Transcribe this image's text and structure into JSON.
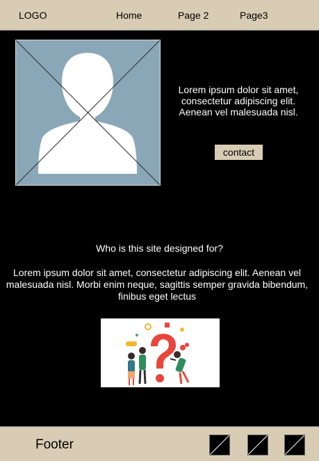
{
  "header": {
    "logo": "LOGO",
    "nav": [
      "Home",
      "Page 2",
      "Page3"
    ]
  },
  "hero": {
    "intro": "Lorem ipsum dolor sit amet, consectetur adipiscing elit. Aenean vel malesuada nisl.",
    "contact_label": "contact",
    "avatar_icon": "user-placeholder-icon"
  },
  "audience": {
    "question": "Who is this site designed for?",
    "body": "Lorem ipsum dolor sit amet, consectetur adipiscing elit. Aenean vel malesuada nisl. Morbi enim neque, sagittis semper gravida bibendum, finibus eget lectus"
  },
  "footer": {
    "label": "Footer",
    "socials": [
      "social-placeholder-icon",
      "social-placeholder-icon",
      "social-placeholder-icon"
    ]
  },
  "colors": {
    "bar": "#d9ccb4",
    "background": "#000000",
    "avatar_bg": "#8aa7b7",
    "question_mark": "#e8463c"
  }
}
